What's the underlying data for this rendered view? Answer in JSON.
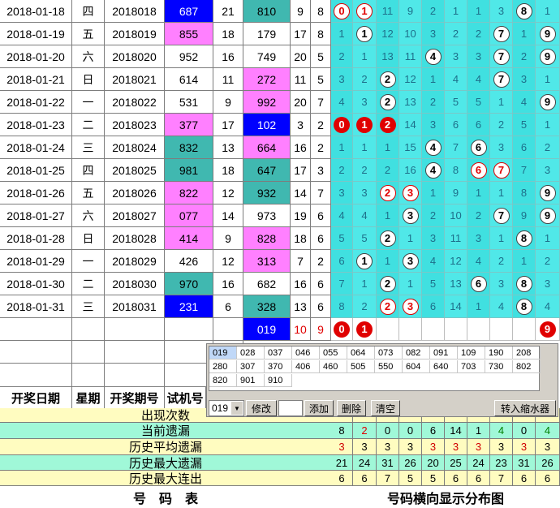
{
  "rows": [
    {
      "date": "2018-01-18",
      "wd": "四",
      "issue": "2018018",
      "test": "687",
      "ts": 21,
      "num": "810",
      "s1": 9,
      "s2": 8,
      "c": [
        "0",
        "1",
        "11",
        "9",
        "2",
        "1",
        "1",
        "3",
        "8",
        "1"
      ],
      "b": [
        0,
        1,
        8
      ]
    },
    {
      "date": "2018-01-19",
      "wd": "五",
      "issue": "2018019",
      "test": "855",
      "ts": 18,
      "num": "179",
      "s1": 17,
      "s2": 8,
      "c": [
        "1",
        "1",
        "12",
        "10",
        "3",
        "2",
        "2",
        "7",
        "1",
        "9"
      ],
      "b": [
        1,
        7,
        9
      ]
    },
    {
      "date": "2018-01-20",
      "wd": "六",
      "issue": "2018020",
      "test": "952",
      "ts": 16,
      "num": "749",
      "s1": 20,
      "s2": 5,
      "c": [
        "2",
        "1",
        "13",
        "11",
        "4",
        "3",
        "3",
        "7",
        "2",
        "9"
      ],
      "b": [
        4,
        7,
        9
      ]
    },
    {
      "date": "2018-01-21",
      "wd": "日",
      "issue": "2018021",
      "test": "614",
      "ts": 11,
      "num": "272",
      "s1": 11,
      "s2": 5,
      "c": [
        "3",
        "2",
        "2",
        "12",
        "1",
        "4",
        "4",
        "7",
        "3",
        "1"
      ],
      "b": [
        2,
        7
      ]
    },
    {
      "date": "2018-01-22",
      "wd": "一",
      "issue": "2018022",
      "test": "531",
      "ts": 9,
      "num": "992",
      "s1": 20,
      "s2": 7,
      "c": [
        "4",
        "3",
        "2",
        "13",
        "2",
        "5",
        "5",
        "1",
        "4",
        "9"
      ],
      "b": [
        2,
        9
      ]
    },
    {
      "date": "2018-01-23",
      "wd": "二",
      "issue": "2018023",
      "test": "377",
      "ts": 17,
      "num": "102",
      "s1": 3,
      "s2": 2,
      "c": [
        "0",
        "1",
        "2",
        "14",
        "3",
        "6",
        "6",
        "2",
        "5",
        "1"
      ],
      "b": [
        0,
        1,
        2
      ]
    },
    {
      "date": "2018-01-24",
      "wd": "三",
      "issue": "2018024",
      "test": "832",
      "ts": 13,
      "num": "664",
      "s1": 16,
      "s2": 2,
      "c": [
        "1",
        "1",
        "1",
        "15",
        "4",
        "7",
        "6",
        "3",
        "6",
        "2"
      ],
      "b": [
        4,
        6
      ]
    },
    {
      "date": "2018-01-25",
      "wd": "四",
      "issue": "2018025",
      "test": "981",
      "ts": 18,
      "num": "647",
      "s1": 17,
      "s2": 3,
      "c": [
        "2",
        "2",
        "2",
        "16",
        "4",
        "8",
        "6",
        "7",
        "7",
        "3"
      ],
      "b": [
        4,
        6,
        7
      ]
    },
    {
      "date": "2018-01-26",
      "wd": "五",
      "issue": "2018026",
      "test": "822",
      "ts": 12,
      "num": "932",
      "s1": 14,
      "s2": 7,
      "c": [
        "3",
        "3",
        "2",
        "3",
        "1",
        "9",
        "1",
        "1",
        "8",
        "9"
      ],
      "b": [
        2,
        3,
        9
      ]
    },
    {
      "date": "2018-01-27",
      "wd": "六",
      "issue": "2018027",
      "test": "077",
      "ts": 14,
      "num": "973",
      "s1": 19,
      "s2": 6,
      "c": [
        "4",
        "4",
        "1",
        "3",
        "2",
        "10",
        "2",
        "7",
        "9",
        "9"
      ],
      "b": [
        3,
        7,
        9
      ]
    },
    {
      "date": "2018-01-28",
      "wd": "日",
      "issue": "2018028",
      "test": "414",
      "ts": 9,
      "num": "828",
      "s1": 18,
      "s2": 6,
      "c": [
        "5",
        "5",
        "2",
        "1",
        "3",
        "11",
        "3",
        "1",
        "8",
        "1"
      ],
      "b": [
        2,
        8
      ]
    },
    {
      "date": "2018-01-29",
      "wd": "一",
      "issue": "2018029",
      "test": "426",
      "ts": 12,
      "num": "313",
      "s1": 7,
      "s2": 2,
      "c": [
        "6",
        "1",
        "1",
        "3",
        "4",
        "12",
        "4",
        "2",
        "1",
        "2"
      ],
      "b": [
        1,
        3
      ]
    },
    {
      "date": "2018-01-30",
      "wd": "二",
      "issue": "2018030",
      "test": "970",
      "ts": 16,
      "num": "682",
      "s1": 16,
      "s2": 6,
      "c": [
        "7",
        "1",
        "2",
        "1",
        "5",
        "13",
        "6",
        "3",
        "8",
        "3"
      ],
      "b": [
        2,
        6,
        8
      ]
    },
    {
      "date": "2018-01-31",
      "wd": "三",
      "issue": "2018031",
      "test": "231",
      "ts": 6,
      "num": "328",
      "s1": 13,
      "s2": 6,
      "c": [
        "8",
        "2",
        "2",
        "3",
        "6",
        "14",
        "1",
        "4",
        "8",
        "4"
      ],
      "b": [
        2,
        3,
        8
      ]
    }
  ],
  "bottom_row": {
    "num": "019",
    "s1": "10",
    "s2": "9",
    "balls": [
      "0",
      "1",
      "9"
    ]
  },
  "headers": {
    "date": "开奖日期",
    "weekday": "星期",
    "issue": "开奖期号",
    "test": "试机号"
  },
  "summary": [
    {
      "label": "出现次数",
      "values": [
        "",
        "",
        "",
        "",
        "",
        "",
        "",
        "",
        "",
        ""
      ]
    },
    {
      "label": "当前遗漏",
      "values": [
        "8",
        "2",
        "0",
        "0",
        "6",
        "14",
        "1",
        "4",
        "0",
        "4"
      ]
    },
    {
      "label": "历史平均遗漏",
      "values": [
        "3",
        "3",
        "3",
        "3",
        "3",
        "3",
        "3",
        "3",
        "3",
        "3"
      ]
    },
    {
      "label": "历史最大遗漏",
      "values": [
        "21",
        "24",
        "31",
        "26",
        "20",
        "25",
        "24",
        "23",
        "31",
        "26"
      ]
    },
    {
      "label": "历史最大连出",
      "values": [
        "6",
        "6",
        "7",
        "5",
        "5",
        "6",
        "6",
        "7",
        "6",
        "6"
      ]
    }
  ],
  "footer": {
    "left": "号　码　表",
    "right": "号码横向显示分布图"
  },
  "panel": {
    "list": [
      "019",
      "028",
      "037",
      "046",
      "055",
      "064",
      "073",
      "082",
      "091",
      "109",
      "190",
      "208",
      "280",
      "307",
      "370",
      "406",
      "460",
      "505",
      "550",
      "604",
      "640",
      "703",
      "730",
      "802",
      "820",
      "901",
      "910"
    ],
    "select_value": "019",
    "modify": "修改",
    "add": "添加",
    "delete": "删除",
    "clear": "清空",
    "transfer": "转入缩水器"
  },
  "colors": {
    "magenta": "#ff80ff",
    "teal": "#40b8b0",
    "blue": "#0000ff",
    "cyan": "#40e0e0",
    "yellow": "#fffcc0",
    "green_row": "#a0f8d8"
  }
}
